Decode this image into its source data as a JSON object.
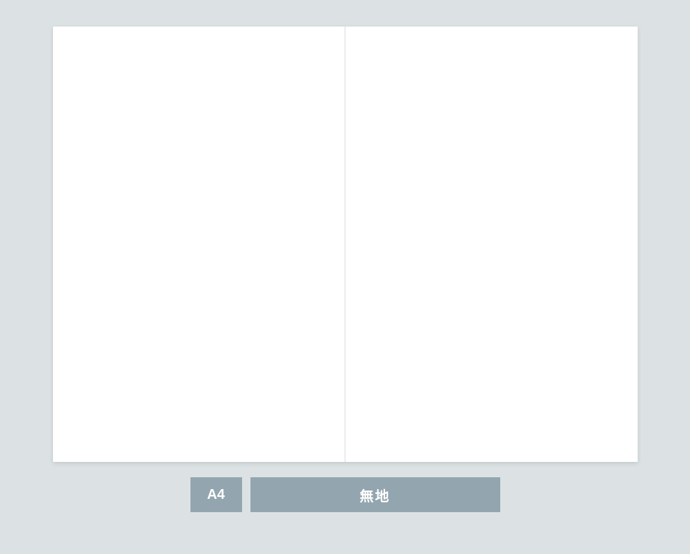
{
  "labels": {
    "size": "A4",
    "style": "無地"
  }
}
